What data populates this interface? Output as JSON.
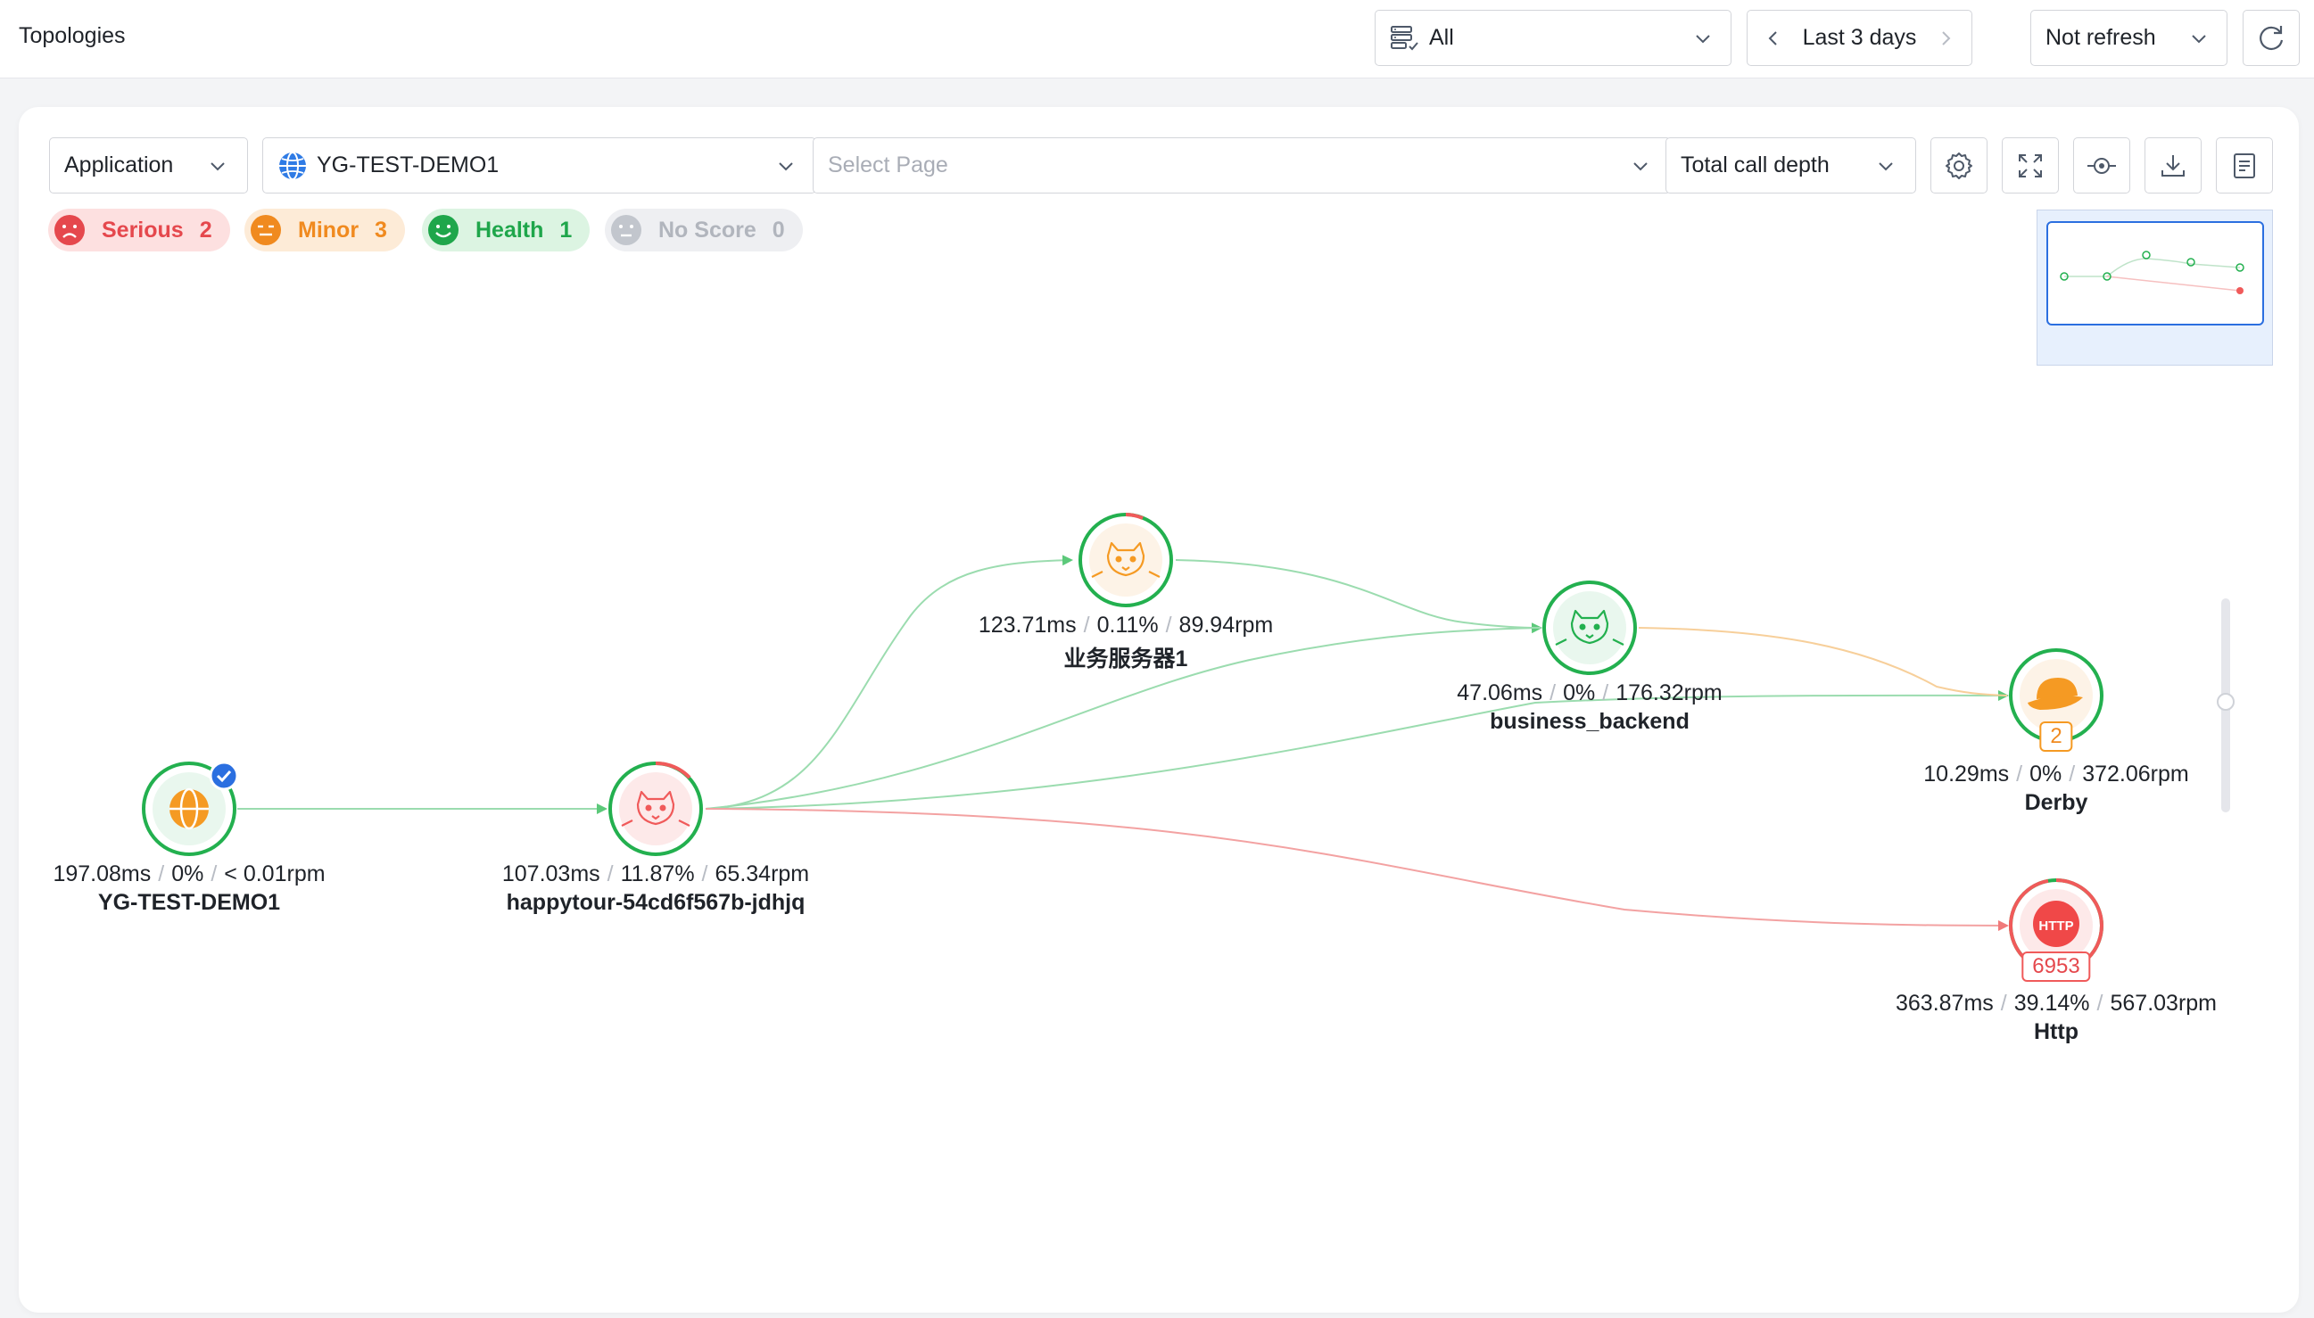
{
  "header": {
    "title": "Topologies",
    "scope": "All",
    "time_range": "Last 3 days",
    "refresh": "Not refresh"
  },
  "toolbar": {
    "type": "Application",
    "application": "YG-TEST-DEMO1",
    "page_placeholder": "Select Page",
    "depth": "Total call depth"
  },
  "scores": {
    "serious": {
      "label": "Serious",
      "count": "2"
    },
    "minor": {
      "label": "Minor",
      "count": "3"
    },
    "health": {
      "label": "Health",
      "count": "1"
    },
    "noscore": {
      "label": "No Score",
      "count": "0"
    }
  },
  "nodes": {
    "demo": {
      "name": "YG-TEST-DEMO1",
      "latency": "197.08ms",
      "error": "0%",
      "rpm": "< 0.01rpm"
    },
    "happytour": {
      "name": "happytour-54cd6f567b-jdhjq",
      "latency": "107.03ms",
      "error": "11.87%",
      "rpm": "65.34rpm"
    },
    "biz1": {
      "name": "业务服务器1",
      "latency": "123.71ms",
      "error": "0.11%",
      "rpm": "89.94rpm"
    },
    "backend": {
      "name": "business_backend",
      "latency": "47.06ms",
      "error": "0%",
      "rpm": "176.32rpm"
    },
    "derby": {
      "name": "Derby",
      "latency": "10.29ms",
      "error": "0%",
      "rpm": "372.06rpm",
      "count": "2"
    },
    "http": {
      "name": "Http",
      "latency": "363.87ms",
      "error": "39.14%",
      "rpm": "567.03rpm",
      "count": "6953",
      "icon_text": "HTTP"
    }
  },
  "colors": {
    "healthy": "#23b04f",
    "serious": "#f05a5a",
    "minor": "#f59a23",
    "accent": "#2b6fe0"
  }
}
